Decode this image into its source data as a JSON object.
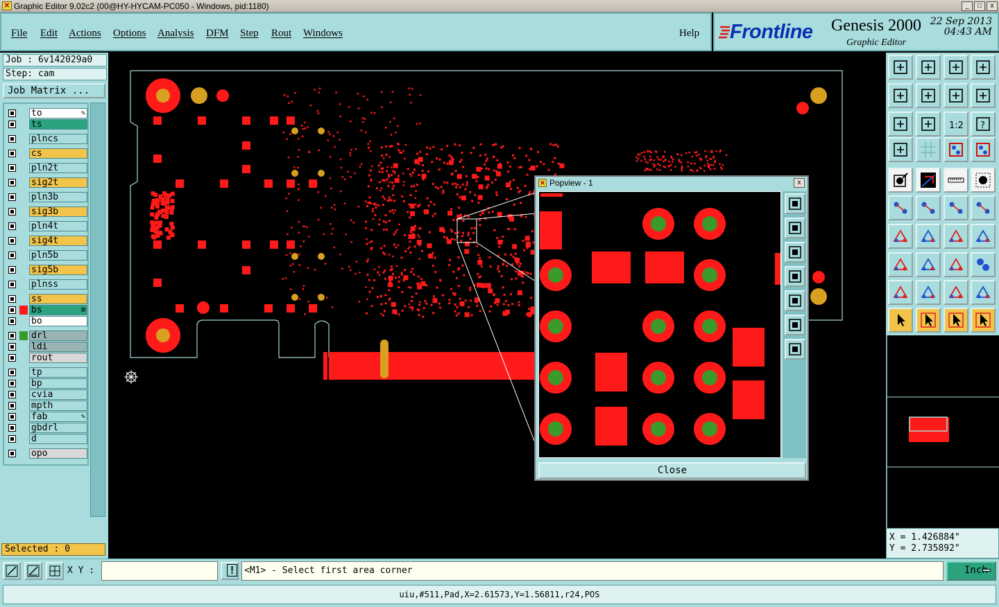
{
  "window": {
    "title": "Graphic Editor 9.02c2 (00@HY-HYCAM-PC050 - Windows, pid:1180)",
    "minimize": "_",
    "maximize": "□",
    "close": "x"
  },
  "menu": {
    "items": [
      "File",
      "Edit",
      "Actions",
      "Options",
      "Analysis",
      "DFM",
      "Step",
      "Rout",
      "Windows"
    ],
    "help": "Help"
  },
  "logo": {
    "brand": "Frontline",
    "product": "Genesis 2000",
    "subtitle": "Graphic Editor",
    "date": "22 Sep 2013",
    "time": "04:43 AM"
  },
  "job": {
    "job_line": "Job : 6v142029a0",
    "step_line": "Step: cam",
    "matrix_button": "Job Matrix ..."
  },
  "layers": [
    {
      "name": "to",
      "bg": "#ffffff",
      "swatch": "",
      "marker": "✎"
    },
    {
      "name": "ts",
      "bg": "#2aa37e",
      "swatch": ""
    },
    {
      "name": "plncs",
      "bg": "#a9dcdd",
      "swatch": ""
    },
    {
      "name": "cs",
      "bg": "#f2c44a",
      "swatch": ""
    },
    {
      "name": "pln2t",
      "bg": "#a9dcdd",
      "swatch": ""
    },
    {
      "name": "sig2t",
      "bg": "#f2c44a",
      "swatch": ""
    },
    {
      "name": "pln3b",
      "bg": "#a9dcdd",
      "swatch": ""
    },
    {
      "name": "sig3b",
      "bg": "#f2c44a",
      "swatch": ""
    },
    {
      "name": "pln4t",
      "bg": "#a9dcdd",
      "swatch": ""
    },
    {
      "name": "sig4t",
      "bg": "#f2c44a",
      "swatch": ""
    },
    {
      "name": "pln5b",
      "bg": "#a9dcdd",
      "swatch": ""
    },
    {
      "name": "sig5b",
      "bg": "#f2c44a",
      "swatch": ""
    },
    {
      "name": "plnss",
      "bg": "#a9dcdd",
      "swatch": ""
    },
    {
      "name": "ss",
      "bg": "#f2c44a",
      "swatch": ""
    },
    {
      "name": "bs",
      "bg": "#2aa37e",
      "swatch": "#ff1a1a",
      "marker": "⊞"
    },
    {
      "name": "bo",
      "bg": "#ffffff",
      "swatch": ""
    },
    {
      "name": "drl",
      "bg": "#9ab4b4",
      "swatch": "#3a9a2a"
    },
    {
      "name": "ldi",
      "bg": "#9ab4b4",
      "swatch": ""
    },
    {
      "name": "rout",
      "bg": "#d8d8d8",
      "swatch": ""
    },
    {
      "name": "tp",
      "bg": "#a9dcdd",
      "swatch": ""
    },
    {
      "name": "bp",
      "bg": "#a9dcdd",
      "swatch": ""
    },
    {
      "name": "cvia",
      "bg": "#a9dcdd",
      "swatch": ""
    },
    {
      "name": "mpth",
      "bg": "#a9dcdd",
      "swatch": ""
    },
    {
      "name": "fab",
      "bg": "#a9dcdd",
      "swatch": "",
      "marker": "✎"
    },
    {
      "name": "gbdrl",
      "bg": "#a9dcdd",
      "swatch": ""
    },
    {
      "name": "d",
      "bg": "#a9dcdd",
      "swatch": ""
    },
    {
      "name": "opo",
      "bg": "#d8d8d8",
      "swatch": ""
    }
  ],
  "selected": "Selected : 0",
  "popview": {
    "title": "Popview - 1",
    "close_x": "x",
    "close_button": "Close"
  },
  "coords": {
    "x": "X = 1.426884\"",
    "y": "Y = 2.735892\""
  },
  "bottom": {
    "xy_label": "X Y :",
    "xy_value": "",
    "info_icon": "!",
    "message": "<M1> - Select first area corner",
    "units": "Inch"
  },
  "status": "uiu,#511,Pad,X=2.61573,Y=1.56811,r24,POS",
  "colors": {
    "panel": "#a9dcdd",
    "pad_red": "#ff1a1a",
    "drill_green": "#3a9a2a",
    "gold": "#d8a020",
    "outline": "#a8d8d8"
  }
}
